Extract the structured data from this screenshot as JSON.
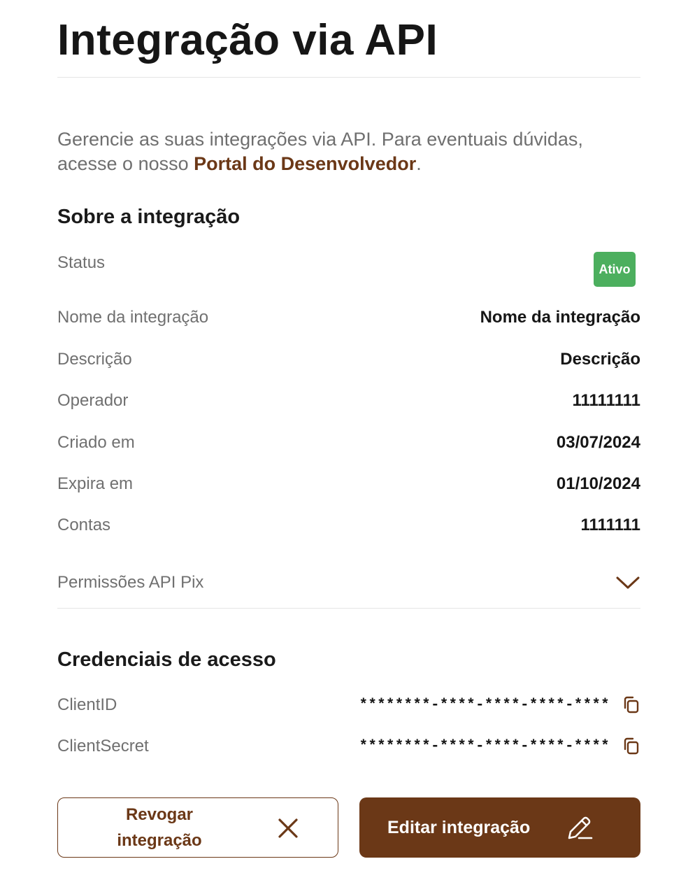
{
  "page": {
    "title": "Integração via API",
    "intro_text": "Gerencie as suas integrações via API. Para eventuais dúvidas, acesse o nosso ",
    "intro_link": "Portal do Desenvolvedor",
    "intro_end": "."
  },
  "about": {
    "section_title": "Sobre a integração",
    "status_label": "Status",
    "status_badge": "Ativo",
    "rows": [
      {
        "label": "Nome da integração",
        "value": "Nome da integração"
      },
      {
        "label": "Descrição",
        "value": "Descrição"
      },
      {
        "label": "Operador",
        "value": "11111111"
      },
      {
        "label": "Criado em",
        "value": "03/07/2024"
      },
      {
        "label": "Expira em",
        "value": "01/10/2024"
      },
      {
        "label": "Contas",
        "value": "1111111"
      }
    ],
    "permissions_label": "Permissões API Pix"
  },
  "credentials": {
    "section_title": "Credenciais de acesso",
    "client_id_label": "ClientID",
    "client_id_value": "********-****-****-****-****",
    "client_secret_label": "ClientSecret",
    "client_secret_value": "********-****-****-****-****"
  },
  "actions": {
    "revoke_label_line1": "Revogar",
    "revoke_label_line2": "integração",
    "edit_label": "Editar integração"
  },
  "colors": {
    "brand": "#6b3817",
    "status_active": "#4caf5e"
  }
}
